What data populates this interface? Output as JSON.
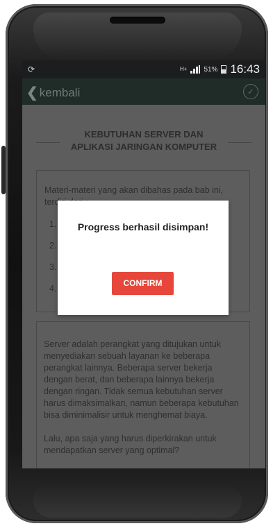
{
  "statusbar": {
    "left_icon": "refresh-icon",
    "network_type": "H+",
    "battery_percent": "51%",
    "time": "16:43"
  },
  "appbar": {
    "back_label": "kembali",
    "back_icon": "chevron-left-icon",
    "action_icon": "check-circle-icon"
  },
  "page": {
    "title_line1": "KEBUTUHAN SERVER DAN",
    "title_line2": "APLIKASI JARINGAN KOMPUTER",
    "intro": "Materi-materi yang akan dibahas pada bab ini, terdiri dari :",
    "list_numbers": [
      "1.",
      "2.",
      "3.",
      "4."
    ],
    "paragraph1": "Server adalah perangkat yang ditujukan untuk menyediakan sebuah layanan ke beberapa perangkat lainnya. Beberapa server bekerja dengan berat, dan beberapa lainnya bekerja dengan ringan. Tidak semua kebutuhan server harus dimaksimalkan, namun beberapa kebutuhan bisa diminimalisir untuk menghemat biaya.",
    "paragraph2": "Lalu, apa saja yang harus diperkirakan untuk mendapatkan server yang optimal?"
  },
  "dialog": {
    "message": "Progress berhasil disimpan!",
    "confirm_label": "CONFIRM"
  },
  "colors": {
    "confirm_button": "#e6473a",
    "appbar": "#1f2c28",
    "statusbar": "#1b1d1f",
    "overlay_background": "#5d5d5d"
  }
}
